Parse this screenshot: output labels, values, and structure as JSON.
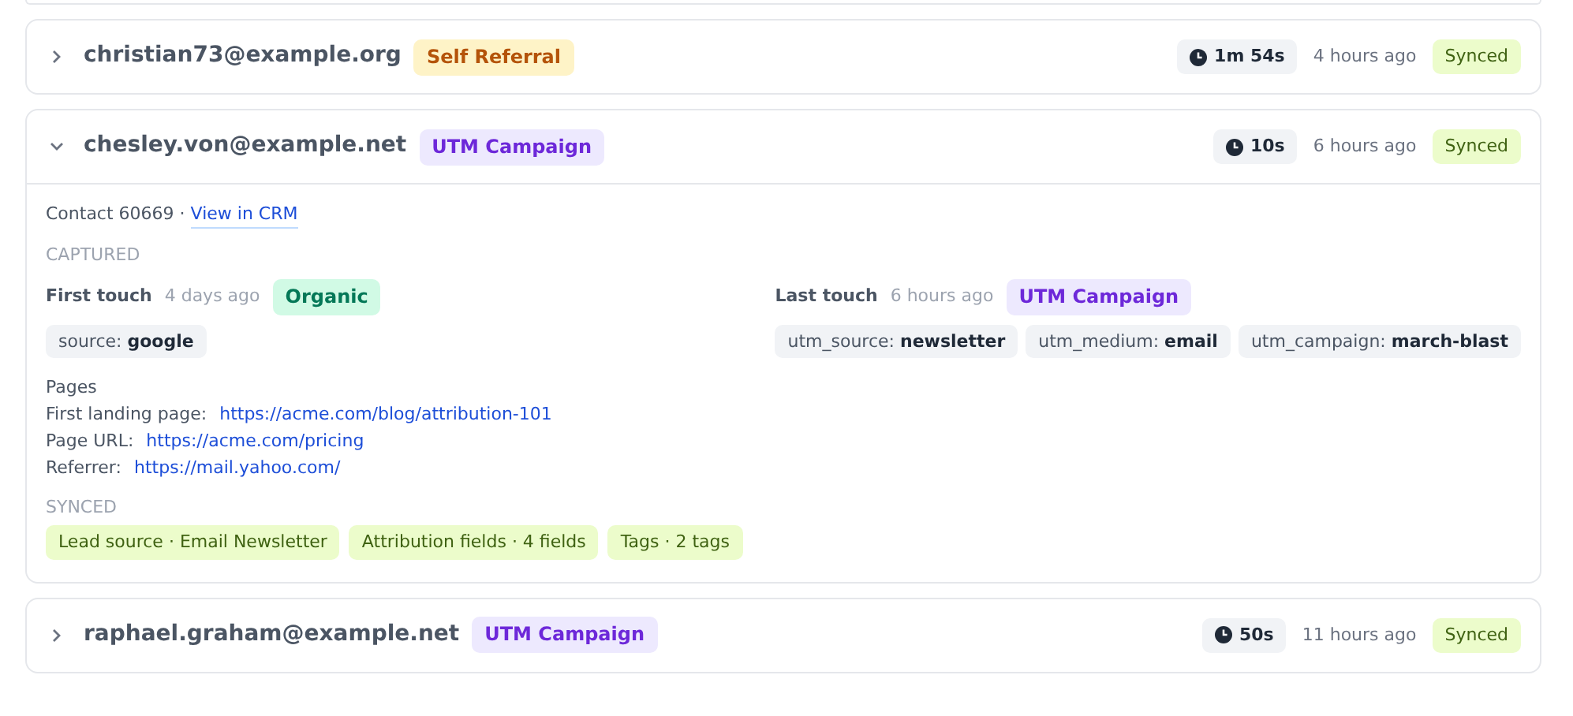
{
  "sessions": [
    {
      "email": "christian73@example.org",
      "expanded": false,
      "source": {
        "label": "Self Referral",
        "kind": "self_referral"
      },
      "duration": "1m 54s",
      "time": "4 hours ago",
      "status": "Synced"
    },
    {
      "email": "chesley.von@example.net",
      "expanded": true,
      "source": {
        "label": "UTM Campaign",
        "kind": "utm"
      },
      "duration": "10s",
      "time": "6 hours ago",
      "status": "Synced",
      "details": {
        "contact": "Contact 60669 ·",
        "crm_link": "View in CRM",
        "captured_heading": "CAPTURED",
        "touches": [
          {
            "label": "First touch",
            "time": "4 days ago",
            "source": {
              "label": "Organic",
              "kind": "organic"
            },
            "params": [
              "source: **google**"
            ]
          },
          {
            "label": "Last touch",
            "time": "6 hours ago",
            "source": {
              "label": "UTM Campaign",
              "kind": "utm"
            },
            "params": [
              "utm_source: **newsletter**",
              "utm_medium: **email**",
              "utm_campaign: **march-blast**"
            ]
          }
        ],
        "pages_heading": "Pages",
        "pages": [
          {
            "label": "First landing page:",
            "url": "https://acme.com/blog/attribution-101"
          },
          {
            "label": "Page URL:",
            "url": "https://acme.com/pricing"
          },
          {
            "label": "Referrer:",
            "url": "https://mail.yahoo.com/"
          }
        ],
        "synced_heading": "SYNCED",
        "synced": [
          "Lead source · Email Newsletter",
          "Attribution fields · 4 fields",
          "Tags · 2 tags"
        ]
      }
    },
    {
      "email": "raphael.graham@example.net",
      "expanded": false,
      "source": {
        "label": "UTM Campaign",
        "kind": "utm"
      },
      "duration": "50s",
      "time": "11 hours ago",
      "status": "Synced"
    }
  ]
}
